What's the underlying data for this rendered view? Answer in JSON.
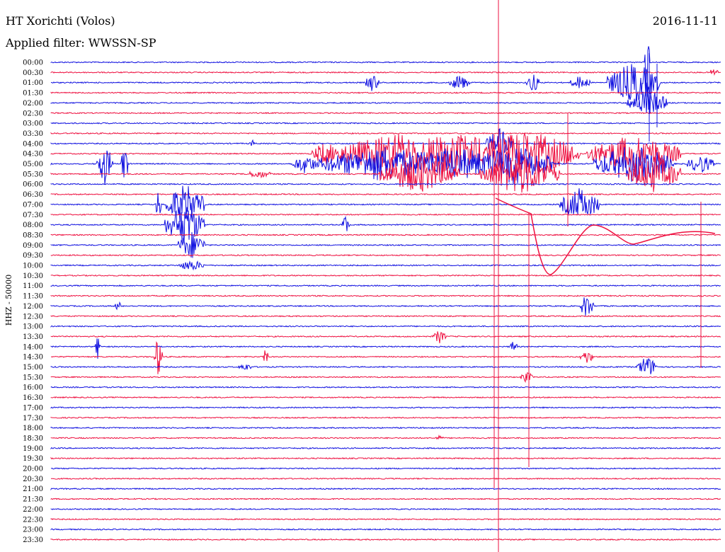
{
  "station": "HT Xorichti (Volos)",
  "filter_text": "Applied filter: WWSSN-SP",
  "date": "2016-11-11",
  "channel_label": "HHZ - 50000",
  "colors": {
    "blue": "#1010e0",
    "red": "#ee1040"
  },
  "chart_data": {
    "type": "line",
    "title": "HT Xorichti (Volos)",
    "ylabel": "HHZ - 50000",
    "rows": [
      "00:00",
      "00:30",
      "01:00",
      "01:30",
      "02:00",
      "02:30",
      "03:00",
      "03:30",
      "04:00",
      "04:30",
      "05:00",
      "05:30",
      "06:00",
      "06:30",
      "07:00",
      "07:30",
      "08:00",
      "08:30",
      "09:00",
      "09:30",
      "10:00",
      "10:30",
      "11:00",
      "11:30",
      "12:00",
      "12:30",
      "13:00",
      "13:30",
      "14:00",
      "14:30",
      "15:00",
      "15:30",
      "16:00",
      "16:30",
      "17:00",
      "17:30",
      "18:00",
      "18:30",
      "19:00",
      "19:30",
      "20:00",
      "20:30",
      "21:00",
      "21:30",
      "22:00",
      "22:30",
      "23:00",
      "23:30"
    ],
    "row_colors": [
      "blue",
      "red"
    ],
    "events": [
      {
        "row": 0,
        "x": 0.89,
        "amp": 60,
        "w": 0.004
      },
      {
        "row": 1,
        "x": 0.99,
        "amp": 8,
        "w": 0.006
      },
      {
        "row": 2,
        "x": 0.48,
        "amp": 14,
        "w": 0.01
      },
      {
        "row": 2,
        "x": 0.61,
        "amp": 12,
        "w": 0.015
      },
      {
        "row": 2,
        "x": 0.72,
        "amp": 14,
        "w": 0.01
      },
      {
        "row": 2,
        "x": 0.79,
        "amp": 10,
        "w": 0.015
      },
      {
        "row": 2,
        "x": 0.87,
        "amp": 30,
        "w": 0.04
      },
      {
        "row": 4,
        "x": 0.89,
        "amp": 20,
        "w": 0.03
      },
      {
        "row": 8,
        "x": 0.3,
        "amp": 6,
        "w": 0.004
      },
      {
        "row": 8,
        "x": 0.67,
        "amp": 22,
        "w": 0.02
      },
      {
        "row": 9,
        "x": 0.41,
        "amp": 18,
        "w": 0.02
      },
      {
        "row": 9,
        "x": 0.52,
        "amp": 30,
        "w": 0.1
      },
      {
        "row": 9,
        "x": 0.6,
        "amp": 30,
        "w": 0.1
      },
      {
        "row": 9,
        "x": 0.71,
        "amp": 34,
        "w": 0.08
      },
      {
        "row": 9,
        "x": 0.87,
        "amp": 28,
        "w": 0.07
      },
      {
        "row": 10,
        "x": 0.08,
        "amp": 30,
        "w": 0.012
      },
      {
        "row": 10,
        "x": 0.11,
        "amp": 28,
        "w": 0.006
      },
      {
        "row": 10,
        "x": 0.38,
        "amp": 14,
        "w": 0.02
      },
      {
        "row": 10,
        "x": 0.5,
        "amp": 26,
        "w": 0.1
      },
      {
        "row": 10,
        "x": 0.6,
        "amp": 24,
        "w": 0.1
      },
      {
        "row": 10,
        "x": 0.69,
        "amp": 30,
        "w": 0.06
      },
      {
        "row": 10,
        "x": 0.87,
        "amp": 28,
        "w": 0.06
      },
      {
        "row": 10,
        "x": 0.97,
        "amp": 14,
        "w": 0.02
      },
      {
        "row": 11,
        "x": 0.31,
        "amp": 6,
        "w": 0.02
      },
      {
        "row": 11,
        "x": 0.55,
        "amp": 28,
        "w": 0.06
      },
      {
        "row": 11,
        "x": 0.7,
        "amp": 30,
        "w": 0.06
      },
      {
        "row": 11,
        "x": 0.9,
        "amp": 28,
        "w": 0.04
      },
      {
        "row": 14,
        "x": 0.16,
        "amp": 28,
        "w": 0.004
      },
      {
        "row": 14,
        "x": 0.2,
        "amp": 30,
        "w": 0.03
      },
      {
        "row": 14,
        "x": 0.79,
        "amp": 24,
        "w": 0.03
      },
      {
        "row": 16,
        "x": 0.2,
        "amp": 30,
        "w": 0.03
      },
      {
        "row": 16,
        "x": 0.44,
        "amp": 16,
        "w": 0.006
      },
      {
        "row": 18,
        "x": 0.21,
        "amp": 20,
        "w": 0.02
      },
      {
        "row": 20,
        "x": 0.21,
        "amp": 8,
        "w": 0.02
      },
      {
        "row": 24,
        "x": 0.8,
        "amp": 18,
        "w": 0.01
      },
      {
        "row": 24,
        "x": 0.1,
        "amp": 10,
        "w": 0.004
      },
      {
        "row": 27,
        "x": 0.58,
        "amp": 10,
        "w": 0.01
      },
      {
        "row": 28,
        "x": 0.07,
        "amp": 18,
        "w": 0.004
      },
      {
        "row": 28,
        "x": 0.69,
        "amp": 10,
        "w": 0.006
      },
      {
        "row": 29,
        "x": 0.16,
        "amp": 30,
        "w": 0.006
      },
      {
        "row": 29,
        "x": 0.32,
        "amp": 14,
        "w": 0.004
      },
      {
        "row": 29,
        "x": 0.8,
        "amp": 10,
        "w": 0.01
      },
      {
        "row": 30,
        "x": 0.29,
        "amp": 6,
        "w": 0.01
      },
      {
        "row": 30,
        "x": 0.89,
        "amp": 16,
        "w": 0.015
      },
      {
        "row": 31,
        "x": 0.71,
        "amp": 8,
        "w": 0.01
      },
      {
        "row": 37,
        "x": 0.58,
        "amp": 4,
        "w": 0.006
      }
    ]
  }
}
